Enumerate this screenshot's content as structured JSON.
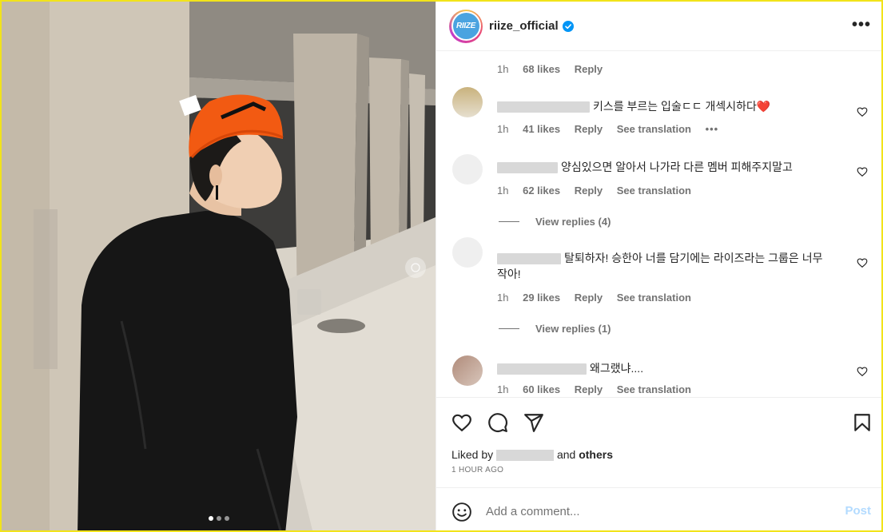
{
  "post": {
    "photo_description_icon": "photo",
    "carousel": {
      "count": 3,
      "active": 0
    }
  },
  "header": {
    "avatar_text": "RIIZE",
    "username": "riize_official",
    "verified_icon": "verified-badge-icon",
    "more_icon": "more-options-icon",
    "more_label": "•••"
  },
  "comments": [
    {
      "text": "",
      "time": "1h",
      "likes": "68 likes",
      "reply": "Reply",
      "translation": "",
      "more": ""
    },
    {
      "text": "키스를 부르는 입술ㄷㄷ 개섹시하다❤️",
      "time": "1h",
      "likes": "41 likes",
      "reply": "Reply",
      "translation": "See translation",
      "more": "•••"
    },
    {
      "text": "양심있으면 알아서 나가라 다른 멤버 피해주지말고",
      "time": "1h",
      "likes": "62 likes",
      "reply": "Reply",
      "translation": "See translation",
      "view_replies": "View replies (4)"
    },
    {
      "text": "탈퇴하자! 승한아 너를 담기에는 라이즈라는 그룹은 너무 작아!",
      "time": "1h",
      "likes": "29 likes",
      "reply": "Reply",
      "translation": "See translation",
      "view_replies": "View replies (1)"
    },
    {
      "text": "왜그랬냐....",
      "time": "1h",
      "likes": "60 likes",
      "reply": "Reply",
      "translation": "See translation"
    }
  ],
  "actions": {
    "like_icon": "heart-icon",
    "comment_icon": "comment-icon",
    "share_icon": "share-icon",
    "save_icon": "bookmark-icon"
  },
  "likes": {
    "prefix": "Liked by",
    "and": "and",
    "others": "others"
  },
  "timestamp": "1 HOUR AGO",
  "add_comment": {
    "emoji_icon": "emoji-icon",
    "placeholder": "Add a comment...",
    "post_label": "Post"
  },
  "colors": {
    "frame": "#f2e31a",
    "beanie": "#f25a12",
    "verified": "#0095f6",
    "post_disabled": "#b3dbff"
  }
}
